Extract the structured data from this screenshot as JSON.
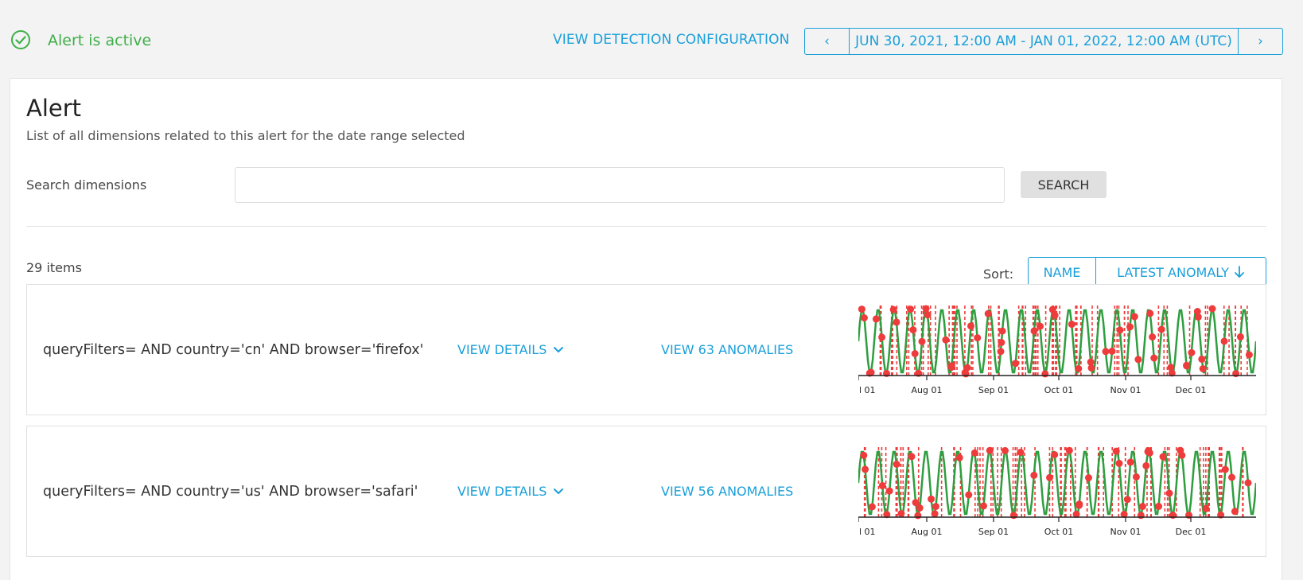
{
  "header": {
    "status_text": "Alert is active",
    "status_color": "#3fae49",
    "config_link": "VIEW DETECTION CONFIGURATION",
    "date_range": "JUN 30, 2021, 12:00 AM - JAN 01, 2022, 12:00 AM (UTC)",
    "prev_label": "‹",
    "next_label": "›"
  },
  "card": {
    "title": "Alert",
    "subtitle": "List of all dimensions related to this alert for the date range selected",
    "search_label": "Search dimensions",
    "search_value": "",
    "search_button": "SEARCH",
    "item_count": "29 items",
    "sort_label": "Sort:",
    "sort_name": "NAME",
    "sort_latest": "LATEST ANOMALY"
  },
  "rows": [
    {
      "query": "queryFilters= AND country='cn' AND browser='firefox'",
      "details_label": "VIEW DETAILS",
      "anomalies_label": "VIEW 63 ANOMALIES",
      "anomaly_count": 63,
      "seed": 7
    },
    {
      "query": "queryFilters= AND country='us' AND browser='safari'",
      "details_label": "VIEW DETAILS",
      "anomalies_label": "VIEW 56 ANOMALIES",
      "anomaly_count": 56,
      "seed": 13
    }
  ],
  "chart_data": {
    "type": "line",
    "x_ticks": [
      "l 01",
      "Aug 01",
      "Sep 01",
      "Oct 01",
      "Nov 01",
      "Dec 01"
    ],
    "series_color": "#2e9e3f",
    "anomaly_color": "#ee3b3b",
    "cycles": 25
  },
  "colors": {
    "accent": "#1a9fd9",
    "success": "#3fae49"
  }
}
